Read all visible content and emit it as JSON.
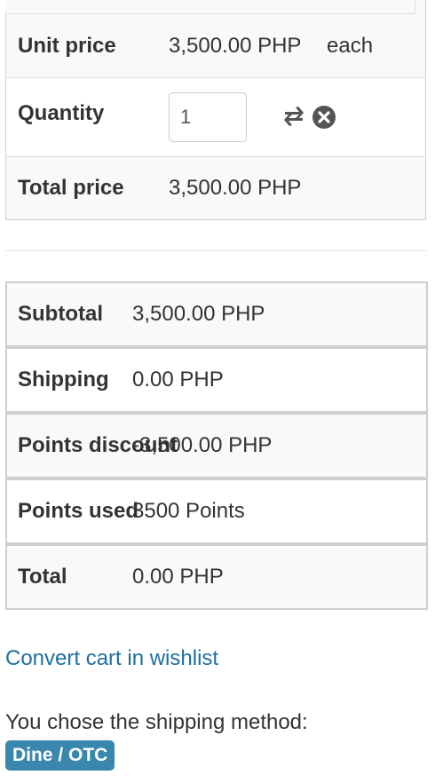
{
  "cart_item": {
    "unit_price_label": "Unit price",
    "unit_price_value": "3,500.00 PHP",
    "unit_price_suffix": "each",
    "quantity_label": "Quantity",
    "quantity_value": "1",
    "total_price_label": "Total price",
    "total_price_value": "3,500.00 PHP"
  },
  "summary": {
    "subtotal_label": "Subtotal",
    "subtotal_value": "3,500.00 PHP",
    "shipping_label": "Shipping",
    "shipping_value": "0.00 PHP",
    "points_discount_label": "Points discount",
    "points_discount_value": "-3,500.00 PHP",
    "points_used_label": "Points used",
    "points_used_value": "3500 Points",
    "total_label": "Total",
    "total_value": "0.00 PHP"
  },
  "links": {
    "convert_cart": "Convert cart in wishlist"
  },
  "shipping_method": {
    "prompt": "You chose the shipping method:",
    "badge": "Dine / OTC"
  },
  "icons": {
    "update": "refresh-icon",
    "remove": "remove-circle-icon"
  },
  "colors": {
    "link": "#1f6f9f",
    "badge_bg": "#3a87ad",
    "row_bg_alt": "#f9f9f9",
    "border": "#cfcfcf"
  }
}
